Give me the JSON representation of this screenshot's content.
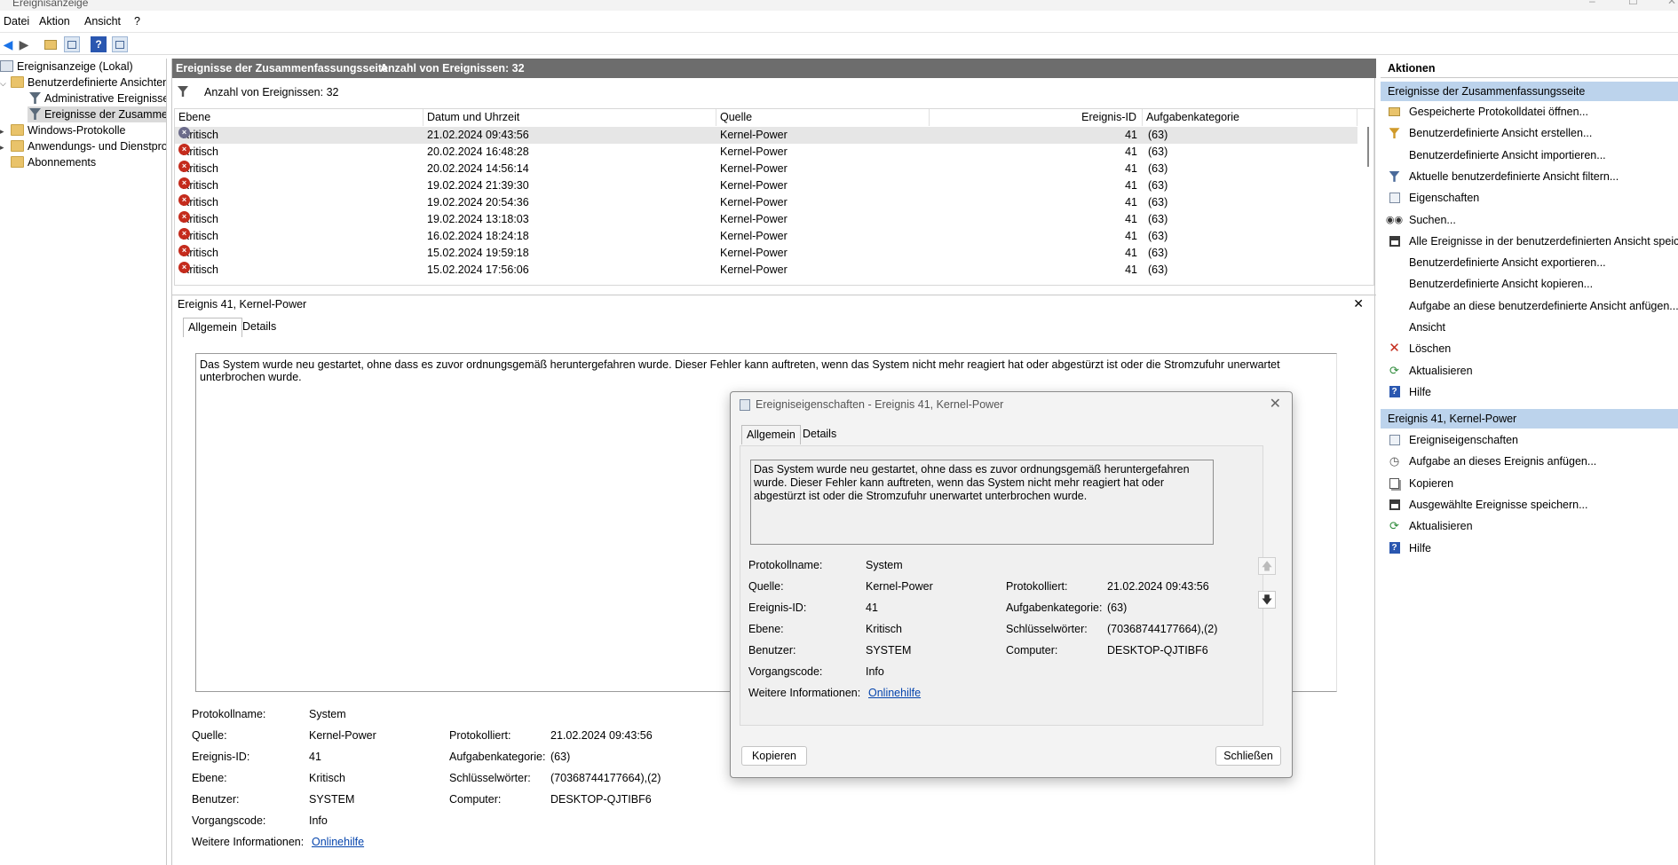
{
  "app": {
    "title": "Ereignisanzeige",
    "window_controls": [
      "–",
      "☐",
      "✕"
    ]
  },
  "menu": [
    "Datei",
    "Aktion",
    "Ansicht",
    "?"
  ],
  "tree": {
    "root": "Ereignisanzeige (Lokal)",
    "custom_views": "Benutzerdefinierte Ansichten",
    "admin_events": "Administrative Ereignisse",
    "summary_events": "Ereignisse der Zusammenfassungsseite",
    "windows_logs": "Windows-Protokolle",
    "app_service_logs": "Anwendungs- und Dienstprotokolle",
    "subscriptions": "Abonnements"
  },
  "center": {
    "header_title": "Ereignisse der Zusammenfassungsseite",
    "header_count": "Anzahl von Ereignissen: 32",
    "filter_text": "Anzahl von Ereignissen: 32",
    "columns": [
      "Ebene",
      "Datum und Uhrzeit",
      "Quelle",
      "Ereignis-ID",
      "Aufgabenkategorie"
    ],
    "rows": [
      {
        "level": "Kritisch",
        "date": "21.02.2024 09:43:56",
        "source": "Kernel-Power",
        "id": "41",
        "category": "(63)"
      },
      {
        "level": "Kritisch",
        "date": "20.02.2024 16:48:28",
        "source": "Kernel-Power",
        "id": "41",
        "category": "(63)"
      },
      {
        "level": "Kritisch",
        "date": "20.02.2024 14:56:14",
        "source": "Kernel-Power",
        "id": "41",
        "category": "(63)"
      },
      {
        "level": "Kritisch",
        "date": "19.02.2024 21:39:30",
        "source": "Kernel-Power",
        "id": "41",
        "category": "(63)"
      },
      {
        "level": "Kritisch",
        "date": "19.02.2024 20:54:36",
        "source": "Kernel-Power",
        "id": "41",
        "category": "(63)"
      },
      {
        "level": "Kritisch",
        "date": "19.02.2024 13:18:03",
        "source": "Kernel-Power",
        "id": "41",
        "category": "(63)"
      },
      {
        "level": "Kritisch",
        "date": "16.02.2024 18:24:18",
        "source": "Kernel-Power",
        "id": "41",
        "category": "(63)"
      },
      {
        "level": "Kritisch",
        "date": "15.02.2024 19:59:18",
        "source": "Kernel-Power",
        "id": "41",
        "category": "(63)"
      },
      {
        "level": "Kritisch",
        "date": "15.02.2024 17:56:06",
        "source": "Kernel-Power",
        "id": "41",
        "category": "(63)"
      }
    ],
    "detail_title": "Ereignis 41, Kernel-Power",
    "detail_close": "✕",
    "tabs": [
      "Allgemein",
      "Details"
    ],
    "description": "Das System wurde neu gestartet, ohne dass es zuvor ordnungsgemäß heruntergefahren wurde. Dieser Fehler kann auftreten, wenn das System nicht mehr reagiert hat oder abgestürzt ist oder die Stromzufuhr unerwartet unterbrochen wurde."
  },
  "props": {
    "log_name_label": "Protokollname:",
    "log_name": "System",
    "source_label": "Quelle:",
    "source": "Kernel-Power",
    "logged_label": "Protokolliert:",
    "logged": "21.02.2024 09:43:56",
    "event_id_label": "Ereignis-ID:",
    "event_id": "41",
    "task_cat_label": "Aufgabenkategorie:",
    "task_cat": "(63)",
    "level_label": "Ebene:",
    "level": "Kritisch",
    "keywords_label": "Schlüsselwörter:",
    "keywords": "(70368744177664),(2)",
    "user_label": "Benutzer:",
    "user": "SYSTEM",
    "computer_label": "Computer:",
    "computer": "DESKTOP-QJTIBF6",
    "opcode_label": "Vorgangscode:",
    "opcode": "Info",
    "more_info_label": "Weitere Informationen:",
    "more_info_link": "Onlinehilfe"
  },
  "actions": {
    "header": "Aktionen",
    "section1": "Ereignisse der Zusammenfassungsseite",
    "items1": [
      "Gespeicherte Protokolldatei öffnen...",
      "Benutzerdefinierte Ansicht erstellen...",
      "Benutzerdefinierte Ansicht importieren...",
      "Aktuelle benutzerdefinierte Ansicht filtern...",
      "Eigenschaften",
      "Suchen...",
      "Alle Ereignisse in der benutzerdefinierten Ansicht speic...",
      "Benutzerdefinierte Ansicht exportieren...",
      "Benutzerdefinierte Ansicht kopieren...",
      "Aufgabe an diese benutzerdefinierte Ansicht anfügen...",
      "Ansicht",
      "Löschen",
      "Aktualisieren",
      "Hilfe"
    ],
    "section2": "Ereignis 41, Kernel-Power",
    "items2": [
      "Ereigniseigenschaften",
      "Aufgabe an dieses Ereignis anfügen...",
      "Kopieren",
      "Ausgewählte Ereignisse speichern...",
      "Aktualisieren",
      "Hilfe"
    ]
  },
  "dialog": {
    "title": "Ereigniseigenschaften - Ereignis 41, Kernel-Power",
    "close": "✕",
    "tabs": [
      "Allgemein",
      "Details"
    ],
    "description": "Das System wurde neu gestartet, ohne dass es zuvor ordnungsgemäß heruntergefahren wurde. Dieser Fehler kann auftreten, wenn das System nicht mehr reagiert hat oder abgestürzt ist oder die Stromzufuhr unerwartet unterbrochen wurde.",
    "copy_button": "Kopieren",
    "close_button": "Schließen"
  },
  "colors": {
    "header_gray": "#6d6d6d",
    "section_blue": "#bcd3ec",
    "error_red": "#c42b1c",
    "link_blue": "#0645ad"
  }
}
